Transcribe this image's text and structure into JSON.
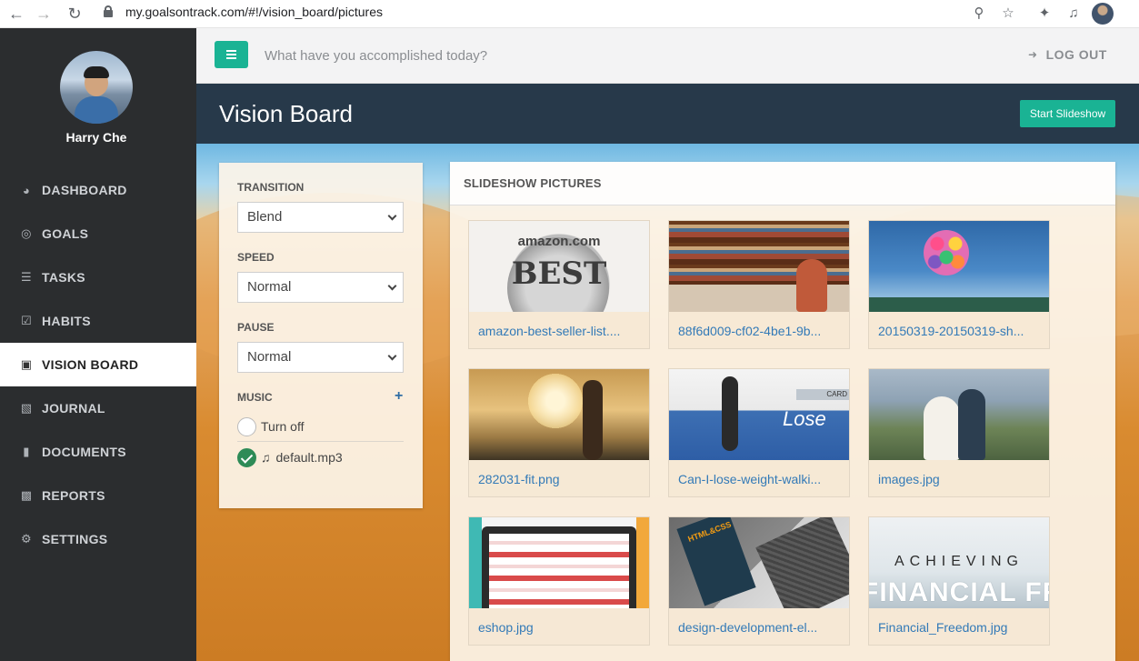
{
  "browser": {
    "url": "my.goalsontrack.com/#!/vision_board/pictures"
  },
  "sidebar": {
    "username": "Harry Che",
    "items": [
      {
        "label": "DASHBOARD",
        "icon": "dashboard-icon"
      },
      {
        "label": "GOALS",
        "icon": "target-icon"
      },
      {
        "label": "TASKS",
        "icon": "list-icon"
      },
      {
        "label": "HABITS",
        "icon": "checkbox-icon"
      },
      {
        "label": "VISION BOARD",
        "icon": "picture-icon"
      },
      {
        "label": "JOURNAL",
        "icon": "book-icon"
      },
      {
        "label": "DOCUMENTS",
        "icon": "file-icon"
      },
      {
        "label": "REPORTS",
        "icon": "bar-chart-icon"
      },
      {
        "label": "SETTINGS",
        "icon": "gear-icon"
      }
    ],
    "active_item": "VISION BOARD"
  },
  "topbar": {
    "placeholder": "What have you accomplished today?",
    "logout_label": "LOG OUT"
  },
  "page": {
    "title": "Vision Board",
    "slideshow_button": "Start Slideshow"
  },
  "settings": {
    "transition_label": "TRANSITION",
    "transition_value": "Blend",
    "speed_label": "SPEED",
    "speed_value": "Normal",
    "pause_label": "PAUSE",
    "pause_value": "Normal",
    "music_label": "MUSIC",
    "music_options": [
      {
        "label": "Turn off",
        "selected": false
      },
      {
        "label": "default.mp3",
        "selected": true
      }
    ]
  },
  "pictures": {
    "title": "SLIDESHOW PICTURES",
    "items": [
      {
        "caption": "amazon-best-seller-list....",
        "art_text_1": "amazon.com",
        "art_text_2": "BEST"
      },
      {
        "caption": "88f6d009-cf02-4be1-9b..."
      },
      {
        "caption": "20150319-20150319-sh..."
      },
      {
        "caption": "282031-fit.png"
      },
      {
        "caption": "Can-I-lose-weight-walki...",
        "art_text_1": "Lose",
        "art_text_2": "CARD"
      },
      {
        "caption": "images.jpg"
      },
      {
        "caption": "eshop.jpg"
      },
      {
        "caption": "design-development-el...",
        "art_text_1": "HTML&CSS"
      },
      {
        "caption": "Financial_Freedom.jpg",
        "art_text_1": "ACHIEVING",
        "art_text_2": "FINANCIAL FREEDOM"
      }
    ]
  },
  "colors": {
    "accent": "#1ab394",
    "sidebar_bg": "#2b2d2f",
    "link": "#337ab7"
  }
}
